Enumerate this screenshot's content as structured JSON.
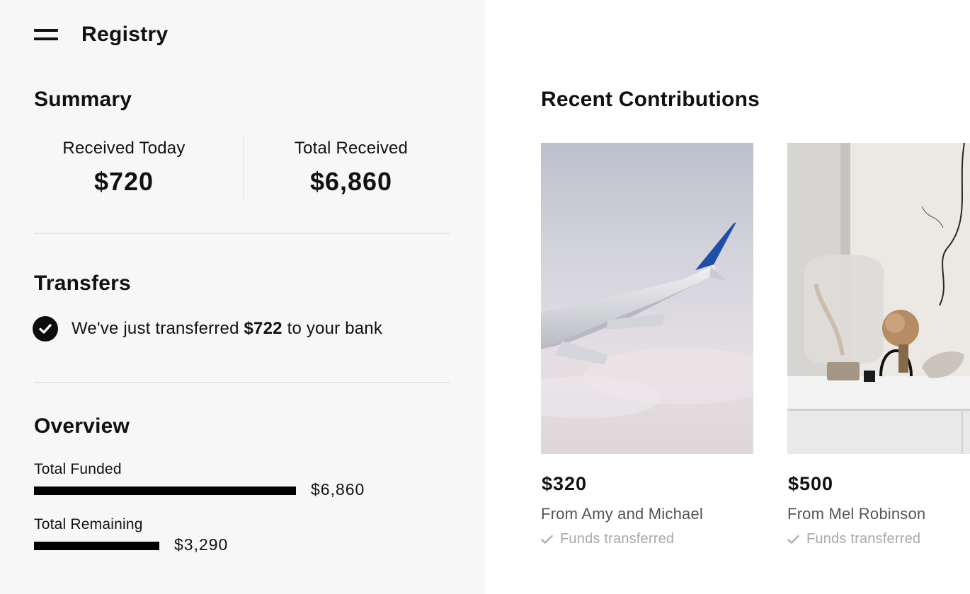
{
  "header": {
    "title": "Registry",
    "menu_icon": "hamburger-menu-icon"
  },
  "summary": {
    "title": "Summary",
    "received_today": {
      "label": "Received Today",
      "value": "$720"
    },
    "total_received": {
      "label": "Total Received",
      "value": "$6,860"
    }
  },
  "transfers": {
    "title": "Transfers",
    "message_before": "We've just transferred ",
    "amount": "$722",
    "message_after": " to your bank",
    "icon": "check-circle-icon"
  },
  "overview": {
    "title": "Overview",
    "items": [
      {
        "label": "Total Funded",
        "value": "$6,860",
        "amount": 6860
      },
      {
        "label": "Total Remaining",
        "value": "$3,290",
        "amount": 3290
      }
    ]
  },
  "recent": {
    "title": "Recent Contributions",
    "cards": [
      {
        "amount": "$320",
        "from": "From Amy and Michael",
        "status": "Funds transferred",
        "image": "airplane-wing-photo"
      },
      {
        "amount": "$500",
        "from": "From Mel Robinson",
        "status": "Funds transferred",
        "image": "home-decor-vase-photo"
      }
    ]
  },
  "colors": {
    "left_panel_bg": "#f7f7f7",
    "text": "#111111",
    "muted": "#a8a8a8",
    "bar": "#000000"
  }
}
